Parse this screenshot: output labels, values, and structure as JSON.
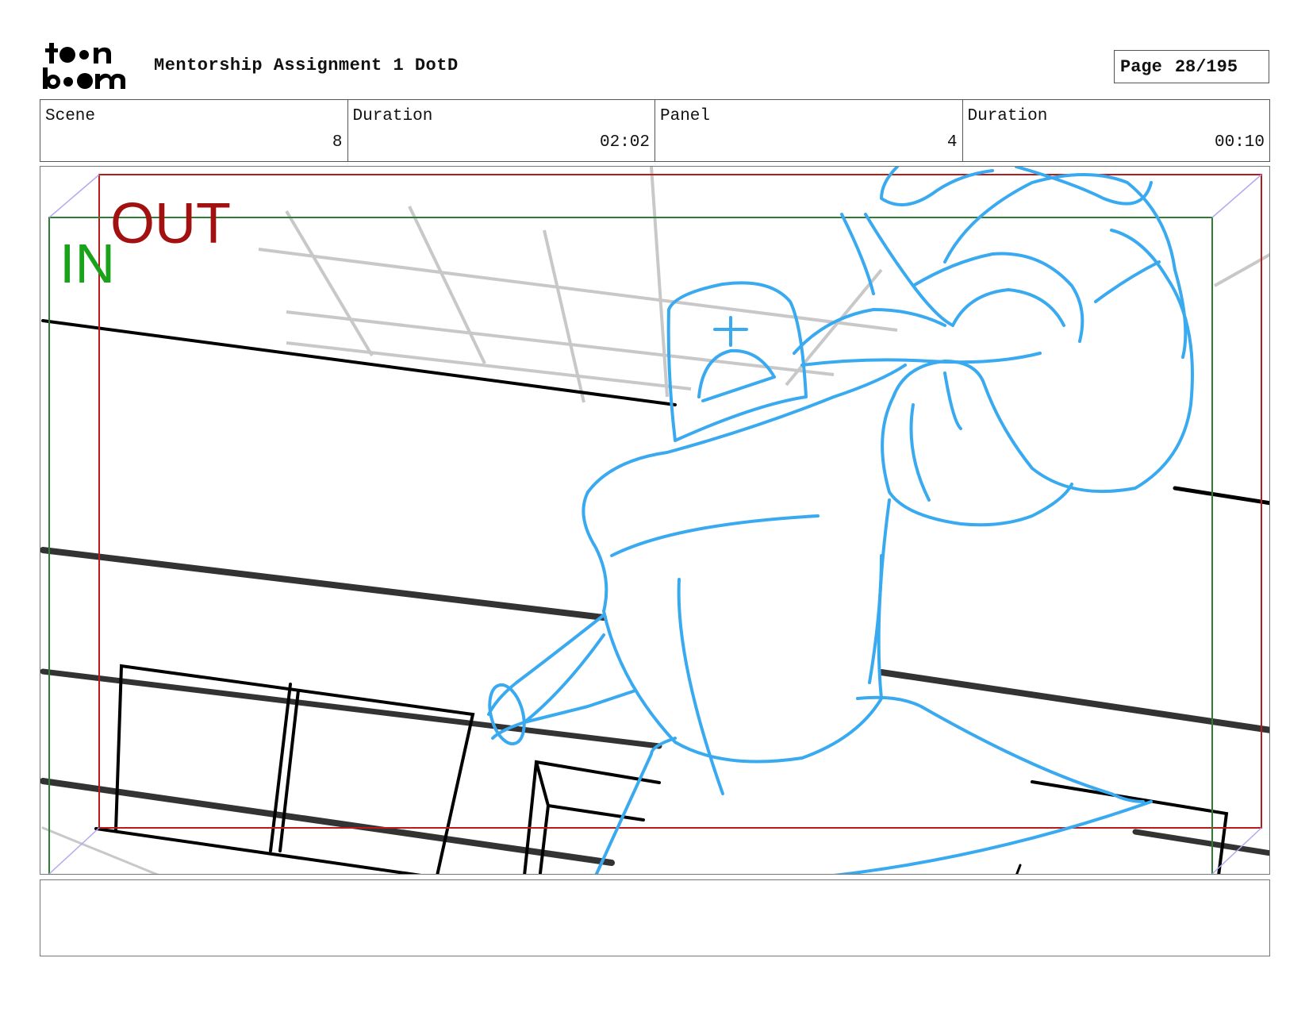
{
  "header": {
    "logo_name": "toon boom",
    "project_title": "Mentorship Assignment 1 DotD",
    "page_label": "Page",
    "page_value": "28/195"
  },
  "info": [
    {
      "label": "Scene",
      "value": "8"
    },
    {
      "label": "Duration",
      "value": "02:02"
    },
    {
      "label": "Panel",
      "value": "4"
    },
    {
      "label": "Duration",
      "value": "00:10"
    }
  ],
  "panel": {
    "in_label": "IN",
    "out_label": "OUT",
    "colors": {
      "in_frame": "#2e7d32",
      "out_frame": "#b71c1c",
      "in_text": "#1aa31a",
      "out_text": "#a31010",
      "sketch": "#3aaaf0",
      "bg_lines": "#000000",
      "grid": "#c8c8c8"
    }
  },
  "notes": {
    "text": ""
  }
}
